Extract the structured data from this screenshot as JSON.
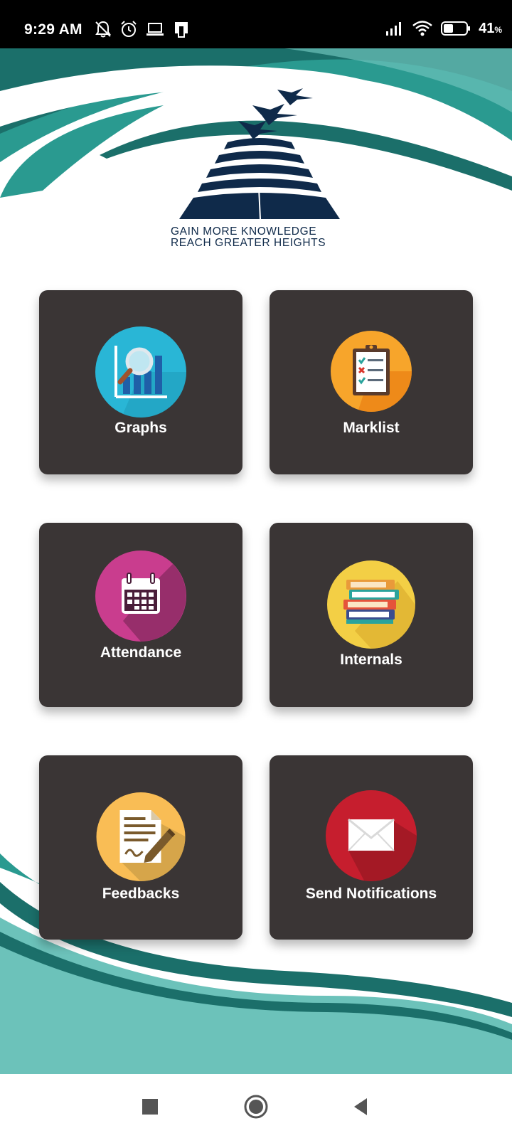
{
  "status_bar": {
    "time": "9:29 AM",
    "battery": "41",
    "battery_unit": "%",
    "left_icons": [
      "bell-off-icon",
      "alarm-icon",
      "laptop-icon",
      "portrait-icon"
    ],
    "right_icons": [
      "signal-icon",
      "wifi-icon",
      "battery-icon"
    ]
  },
  "logo": {
    "line1": "GAIN  MORE  KNOWLEDGE",
    "line2": "REACH GREATER HEIGHTS"
  },
  "menu": [
    {
      "id": "graphs",
      "label": "Graphs",
      "icon": "graph-magnifier-icon",
      "icon_color": "#29b6d6"
    },
    {
      "id": "marklist",
      "label": "Marklist",
      "icon": "clipboard-checklist-icon",
      "icon_color": "#f7a52b"
    },
    {
      "id": "attendance",
      "label": "Attendance",
      "icon": "calendar-icon",
      "icon_color": "#c93d8e"
    },
    {
      "id": "internals",
      "label": "Internals",
      "icon": "books-icon",
      "icon_color": "#f3cf45"
    },
    {
      "id": "feedbacks",
      "label": "Feedbacks",
      "icon": "document-pen-icon",
      "icon_color": "#f9bd55"
    },
    {
      "id": "send-notifications",
      "label": "Send Notifications",
      "icon": "envelope-icon",
      "icon_color": "#c61e2e"
    }
  ],
  "nav_bar": {
    "buttons": [
      "recents-square-icon",
      "home-circle-icon",
      "back-triangle-icon"
    ]
  },
  "colors": {
    "tile_bg": "#3a3535",
    "teal_dark": "#1b6f6a",
    "teal": "#2a9a90",
    "teal_light": "#6cc2ba",
    "logo_navy": "#0f2a4a"
  }
}
